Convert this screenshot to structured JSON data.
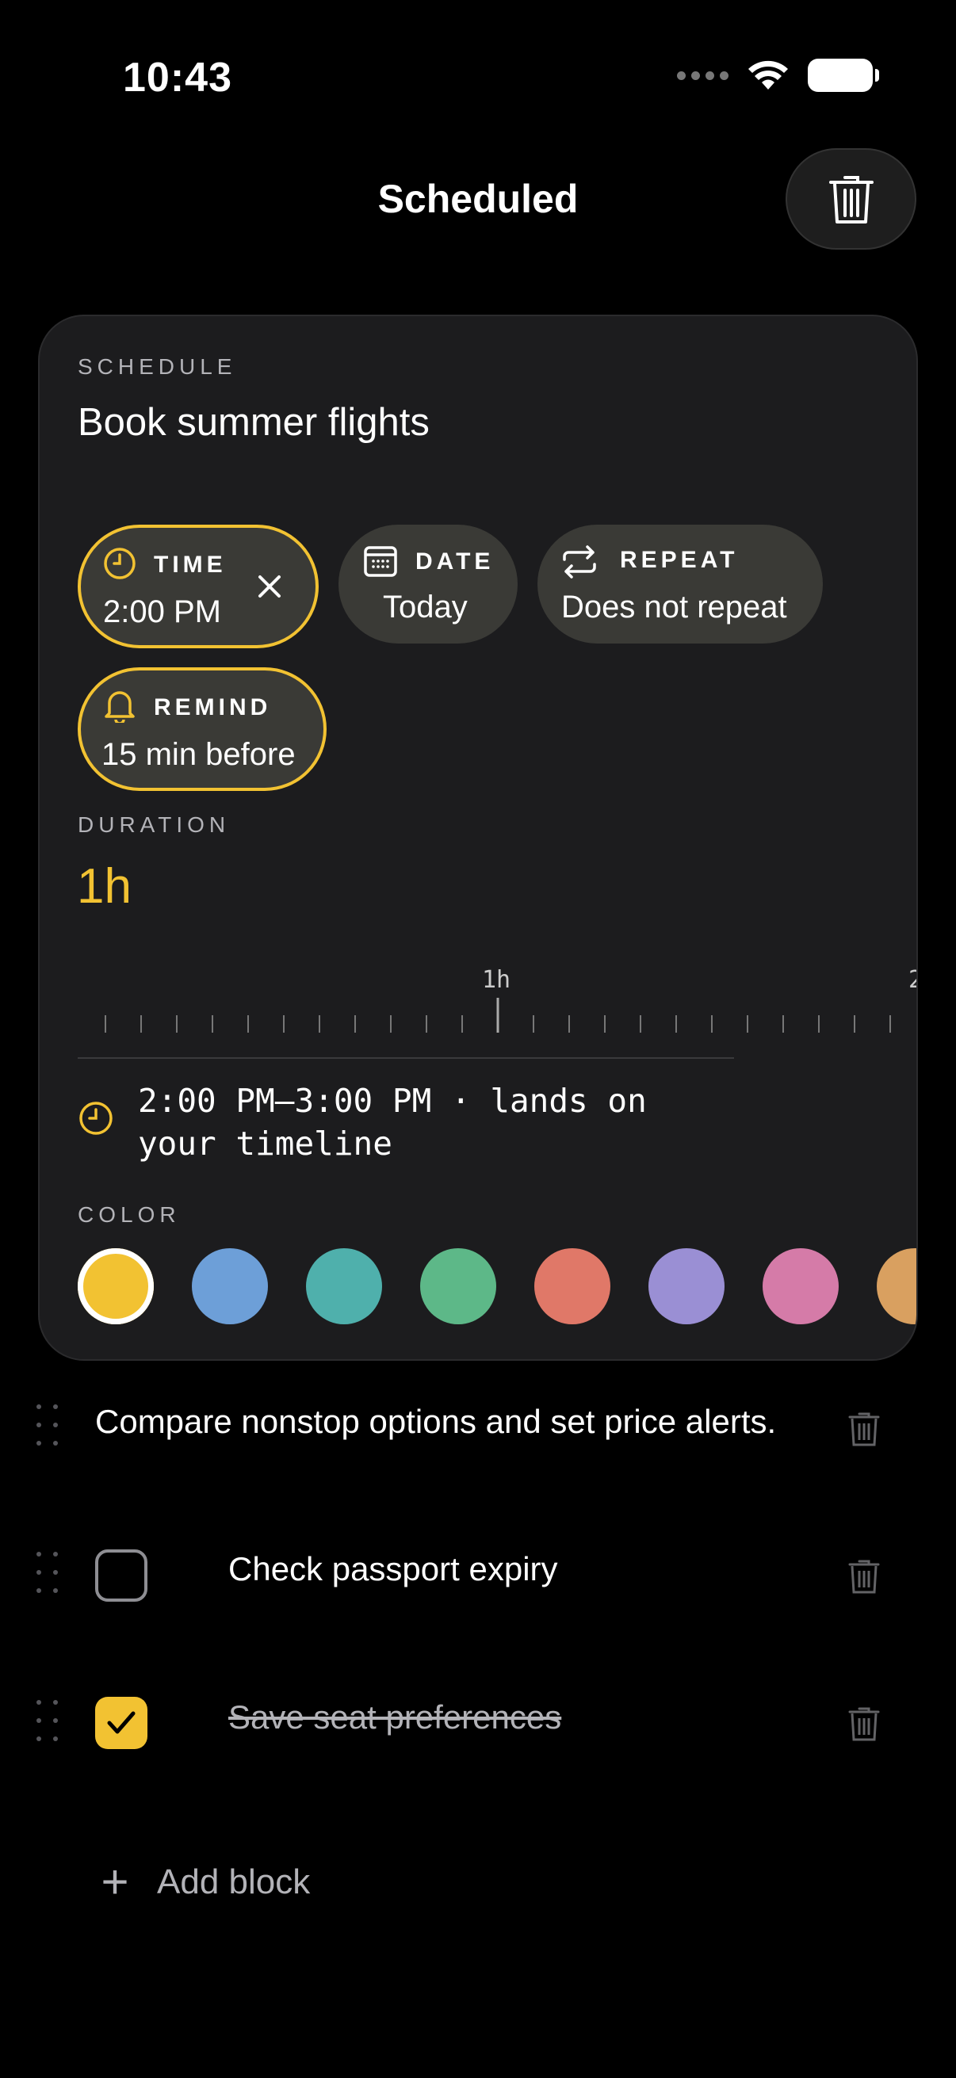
{
  "status_bar": {
    "time": "10:43"
  },
  "header": {
    "title": "Scheduled"
  },
  "schedule_card": {
    "section_label": "SCHEDULE",
    "task_title": "Book summer flights",
    "chips": {
      "time": {
        "label": "TIME",
        "value": "2:00 PM"
      },
      "date": {
        "label": "DATE",
        "value": "Today"
      },
      "repeat": {
        "label": "REPEAT",
        "value": "Does not repeat"
      },
      "remind": {
        "label": "REMIND",
        "value": "15 min before"
      }
    },
    "duration_label": "DURATION",
    "duration_value": "1h",
    "ruler_labels": [
      "1h",
      "2"
    ],
    "range_line_1": "2:00 PM–3:00 PM · lands on",
    "range_line_2": "your timeline",
    "color_label": "COLOR",
    "colors": [
      "#f2c232",
      "#6d9fd8",
      "#4fb0ac",
      "#5db888",
      "#e07868",
      "#9a8fd4",
      "#d57ba8",
      "#d9a060"
    ],
    "selected_color": "#f2c232",
    "accent": "#f2c232"
  },
  "blocks": [
    {
      "type": "text",
      "text": "Compare nonstop options and set price alerts."
    },
    {
      "type": "checklist",
      "text": "Check passport expiry",
      "checked": false
    },
    {
      "type": "checklist",
      "text": "Save seat preferences",
      "checked": true
    }
  ],
  "add_block": {
    "label": "Add block"
  }
}
